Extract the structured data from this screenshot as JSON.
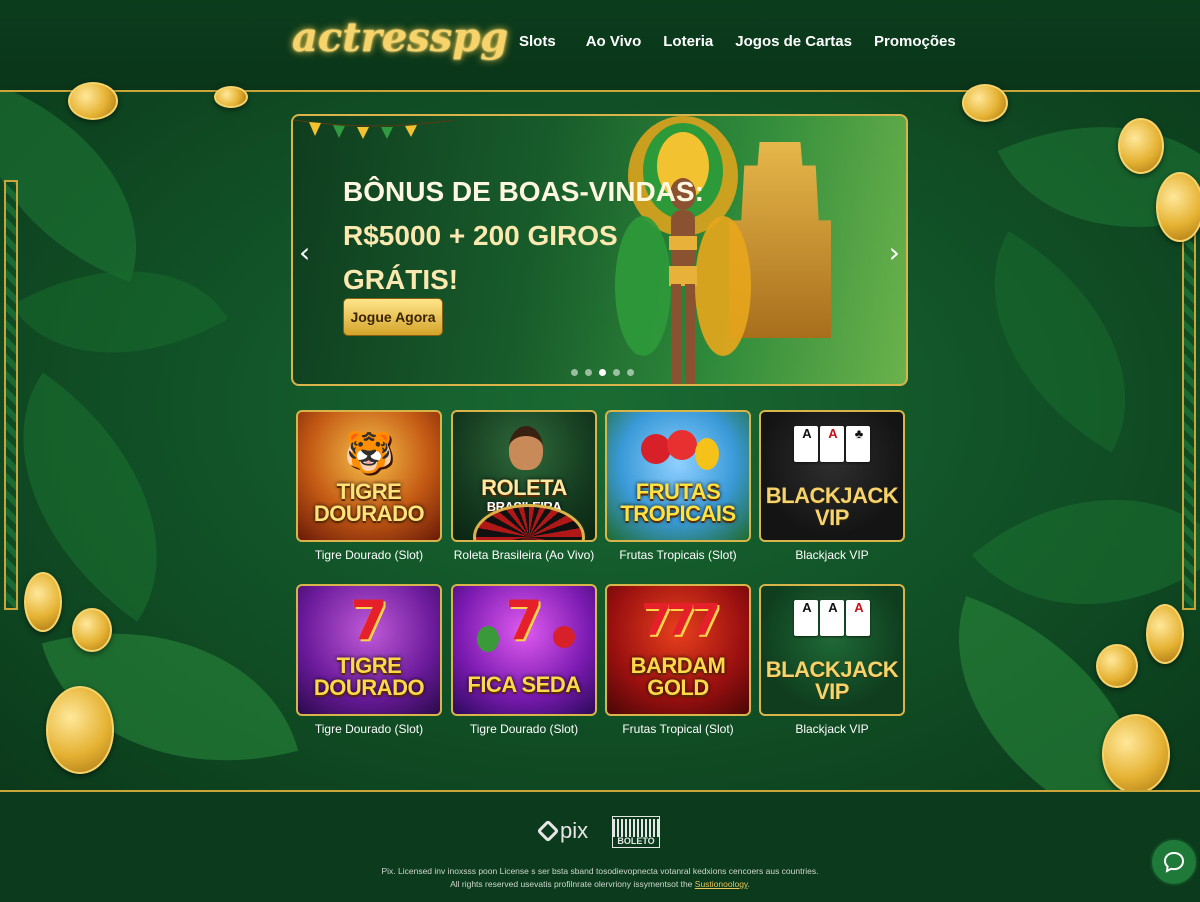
{
  "brand": {
    "logo": "actresspg",
    "gold": "#f6d36b",
    "green": "#0b3d1d"
  },
  "nav": [
    {
      "label": "Slots"
    },
    {
      "label": "Ao Vivo"
    },
    {
      "label": "Loteria"
    },
    {
      "label": "Jogos de Cartas"
    },
    {
      "label": "Promoções"
    }
  ],
  "banner": {
    "title_line1": "BÔNUS DE BOAS-VINDAS:",
    "title_line2": "R$5000 + 200 GIROS",
    "title_line3": "GRÁTIS!",
    "cta": "Jogue Agora",
    "prev_icon": "chevron-left-icon",
    "next_icon": "chevron-right-icon",
    "slides": 5,
    "active_slide": 3
  },
  "games": [
    {
      "thumb_title": "TIGRE",
      "thumb_title2": "DOURADO",
      "label": "Tigre Dourado (Slot)"
    },
    {
      "thumb_title": "ROLETA",
      "thumb_title2": "BRASILEIRA",
      "label": "Roleta Brasileira (Ao Vivo)"
    },
    {
      "thumb_title": "FRUTAS",
      "thumb_title2": "TROPICAIS",
      "label": "Frutas Tropicais (Slot)"
    },
    {
      "thumb_title": "BLACKJACK",
      "thumb_title2": "VIP",
      "label": "Blackjack VIP"
    },
    {
      "thumb_title": "TIGRE",
      "thumb_title2": "DOURADO",
      "label": "Tigre Dourado (Slot)"
    },
    {
      "thumb_title": "FICA SEDA",
      "thumb_title2": "",
      "label": "Tigre Dourado (Slot)"
    },
    {
      "thumb_title": "BARDAM",
      "thumb_title2": "GOLD",
      "label": "Frutas Tropical (Slot)"
    },
    {
      "thumb_title": "BLACKJACK",
      "thumb_title2": "VIP",
      "label": "Blackjack VIP"
    }
  ],
  "footer": {
    "pix": "pix",
    "boleto": "BOLETO",
    "legal_line1": "Pix. Licensed inv inoxsss poon License s ser bsta sband tosodievopnecta votanral kedxions cencoers aus countries.",
    "legal_line2a": "All rights reserved usevatis profilnrate olervriony issymentsot the ",
    "legal_link": "Sustionoology",
    "legal_line2b": "."
  },
  "chat_icon": "chat-bubble-icon"
}
